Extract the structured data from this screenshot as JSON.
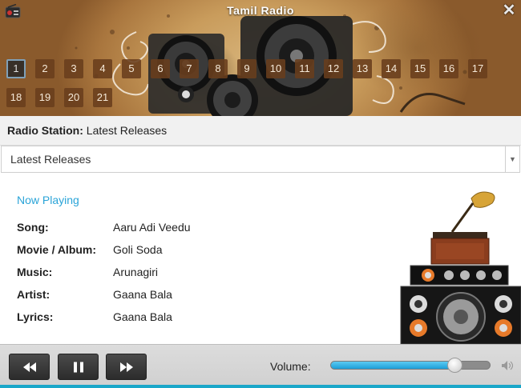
{
  "window": {
    "title": "Tamil Radio",
    "close_glyph": "✕",
    "icon": "radio-icon"
  },
  "stations": [
    "1",
    "2",
    "3",
    "4",
    "5",
    "6",
    "7",
    "8",
    "9",
    "10",
    "11",
    "12",
    "13",
    "14",
    "15",
    "16",
    "17",
    "18",
    "19",
    "20",
    "21"
  ],
  "active_station": "1",
  "station_label": {
    "key": "Radio Station:",
    "value": "Latest Releases"
  },
  "station_select": {
    "selected": "Latest Releases",
    "arrow": "▼"
  },
  "now_playing": {
    "heading": "Now Playing",
    "song_label": "Song:",
    "song": "Aaru Adi Veedu",
    "movie_label": "Movie / Album:",
    "movie": "Goli Soda",
    "music_label": "Music:",
    "music": "Arunagiri",
    "artist_label": "Artist:",
    "artist": "Gaana Bala",
    "lyrics_label": "Lyrics:",
    "lyrics": "Gaana Bala"
  },
  "controls": {
    "rewind_icon": "rewind-icon",
    "pause_icon": "pause-icon",
    "forward_icon": "fast-forward-icon",
    "volume_label": "Volume:",
    "volume_level": 0.78
  },
  "colors": {
    "accent": "#2aa4d8",
    "station_button": "#693e1c",
    "footer_line": "#1aa7c9"
  }
}
